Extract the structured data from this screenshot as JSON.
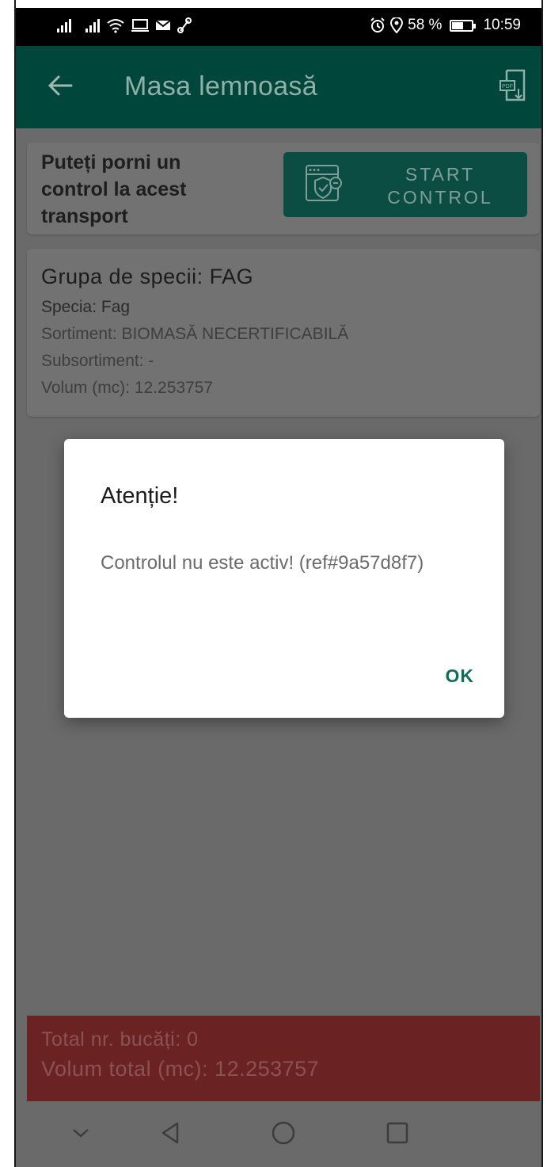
{
  "status_bar": {
    "battery_percent": "58 %",
    "battery_level": 0.58,
    "time": "10:59",
    "icons": [
      "signal-icon",
      "signal-icon",
      "wifi-icon",
      "screen-icon",
      "mail-icon",
      "link-icon",
      "alarm-icon",
      "location-icon",
      "battery-icon"
    ]
  },
  "app_bar": {
    "title": "Masa lemnoasă",
    "back_icon": "back-arrow-icon",
    "action_icon": "pdf-download-icon"
  },
  "control_card": {
    "message": "Puteți porni un control la acest transport",
    "start_button_label": "START CONTROL",
    "start_button_icon": "shield-check-icon"
  },
  "species_card": {
    "group": "Grupa de specii: FAG",
    "species": "Specia: Fag",
    "assortment": "Sortiment: BIOMASĂ NECERTIFICABILĂ",
    "subassortment": "Subsortiment: -",
    "volume": "Volum (mc): 12.253757"
  },
  "totals": {
    "pieces": "Total nr. bucăți: 0",
    "volume": "Volum total (mc): 12.253757"
  },
  "dialog": {
    "title": "Atenție!",
    "message": "Controlul nu este activ! (ref#9a57d8f7)",
    "ok_label": "OK"
  },
  "nav_bar": {
    "icons": [
      "collapse-icon",
      "back-triangle-icon",
      "home-circle-icon",
      "recents-square-icon"
    ]
  },
  "colors": {
    "app_bar": "#00463a",
    "start_button": "#0b4d42",
    "totals_bar": "#6a2222",
    "dialog_ok": "#0d6e5a",
    "scrim": "#6a6a6a"
  }
}
